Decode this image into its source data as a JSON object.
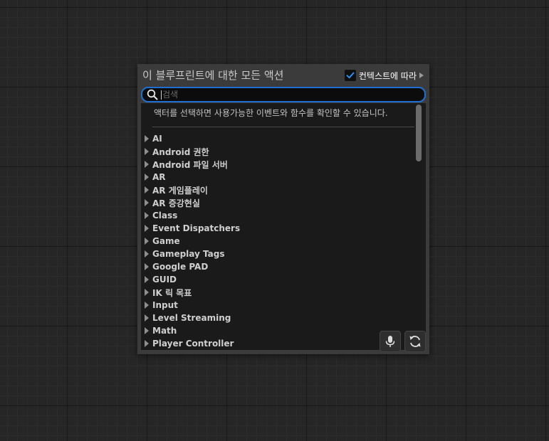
{
  "menu": {
    "title": "이 블루프린트에 대한 모든 액션",
    "context_sensitive": {
      "label": "컨텍스트에 따라",
      "checked": true
    }
  },
  "search": {
    "value": "",
    "placeholder": "검색",
    "icon": "search-icon"
  },
  "hint": "액터를 선택하면 사용가능한 이벤트와 함수를 확인할 수 있습니다.",
  "categories": [
    "AI",
    "Android 권한",
    "Android 파일 서버",
    "AR",
    "AR 게임플레이",
    "AR 증강현실",
    "Class",
    "Event Dispatchers",
    "Game",
    "Gameplay Tags",
    "Google PAD",
    "GUID",
    "IK 릭 목표",
    "Input",
    "Level Streaming",
    "Math",
    "Player Controller"
  ],
  "buttons": {
    "voice": "microphone-icon",
    "refresh": "refresh-icon"
  },
  "colors": {
    "accent": "#1f6fd0",
    "background": "#262626",
    "panel": "#3b3b3b",
    "list_background": "#1a1a1a"
  }
}
